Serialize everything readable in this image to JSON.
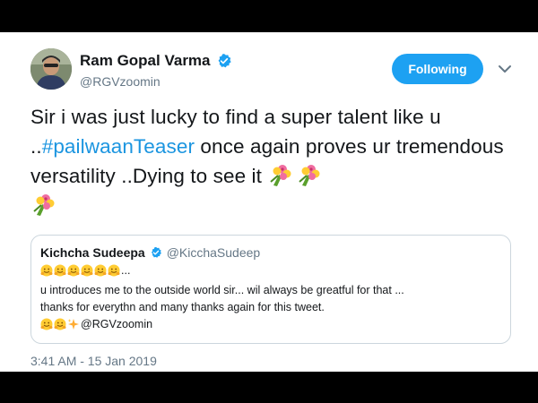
{
  "tweet": {
    "author_name": "Ram Gopal Varma",
    "author_handle": "@RGVzoomin",
    "follow_label": "Following",
    "text_part1": "Sir i was just lucky to find a super talent like u ..",
    "hashtag": "#pailwaanTeaser",
    "text_part2": " once again proves ur tremendous versatility  ..Dying to see it ",
    "emojis": [
      "bouquet-icon",
      "bouquet-icon",
      "bouquet-icon"
    ],
    "timestamp": "3:41 AM - 15 Jan 2019"
  },
  "quoted_tweet": {
    "author_name": "Kichcha Sudeepa",
    "author_handle": "@KicchaSudeep",
    "line1_suffix": "...",
    "line2": "u introduces me to the outside world sir... wil always be greatful for that ...",
    "line3": "thanks for everythn and many thanks again for this tweet.",
    "line4_mention": "@RGVzoomin"
  },
  "colors": {
    "accent": "#1da1f2",
    "hashtag": "#1b95e0",
    "secondary_text": "#657786",
    "border": "#ccd6dd"
  }
}
